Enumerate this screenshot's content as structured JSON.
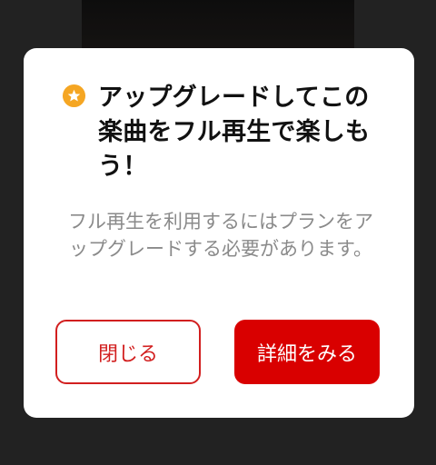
{
  "dialog": {
    "title": "アップグレードしてこの楽曲をフル再生で楽しもう！",
    "body": "フル再生を利用するにはプランをアップグレードする必要があります。",
    "close_label": "閉じる",
    "details_label": "詳細をみる"
  },
  "icons": {
    "title_icon": "star-icon"
  },
  "colors": {
    "accent_red": "#d90000",
    "outline_red": "#d21f1f",
    "star_orange": "#f5a623"
  }
}
